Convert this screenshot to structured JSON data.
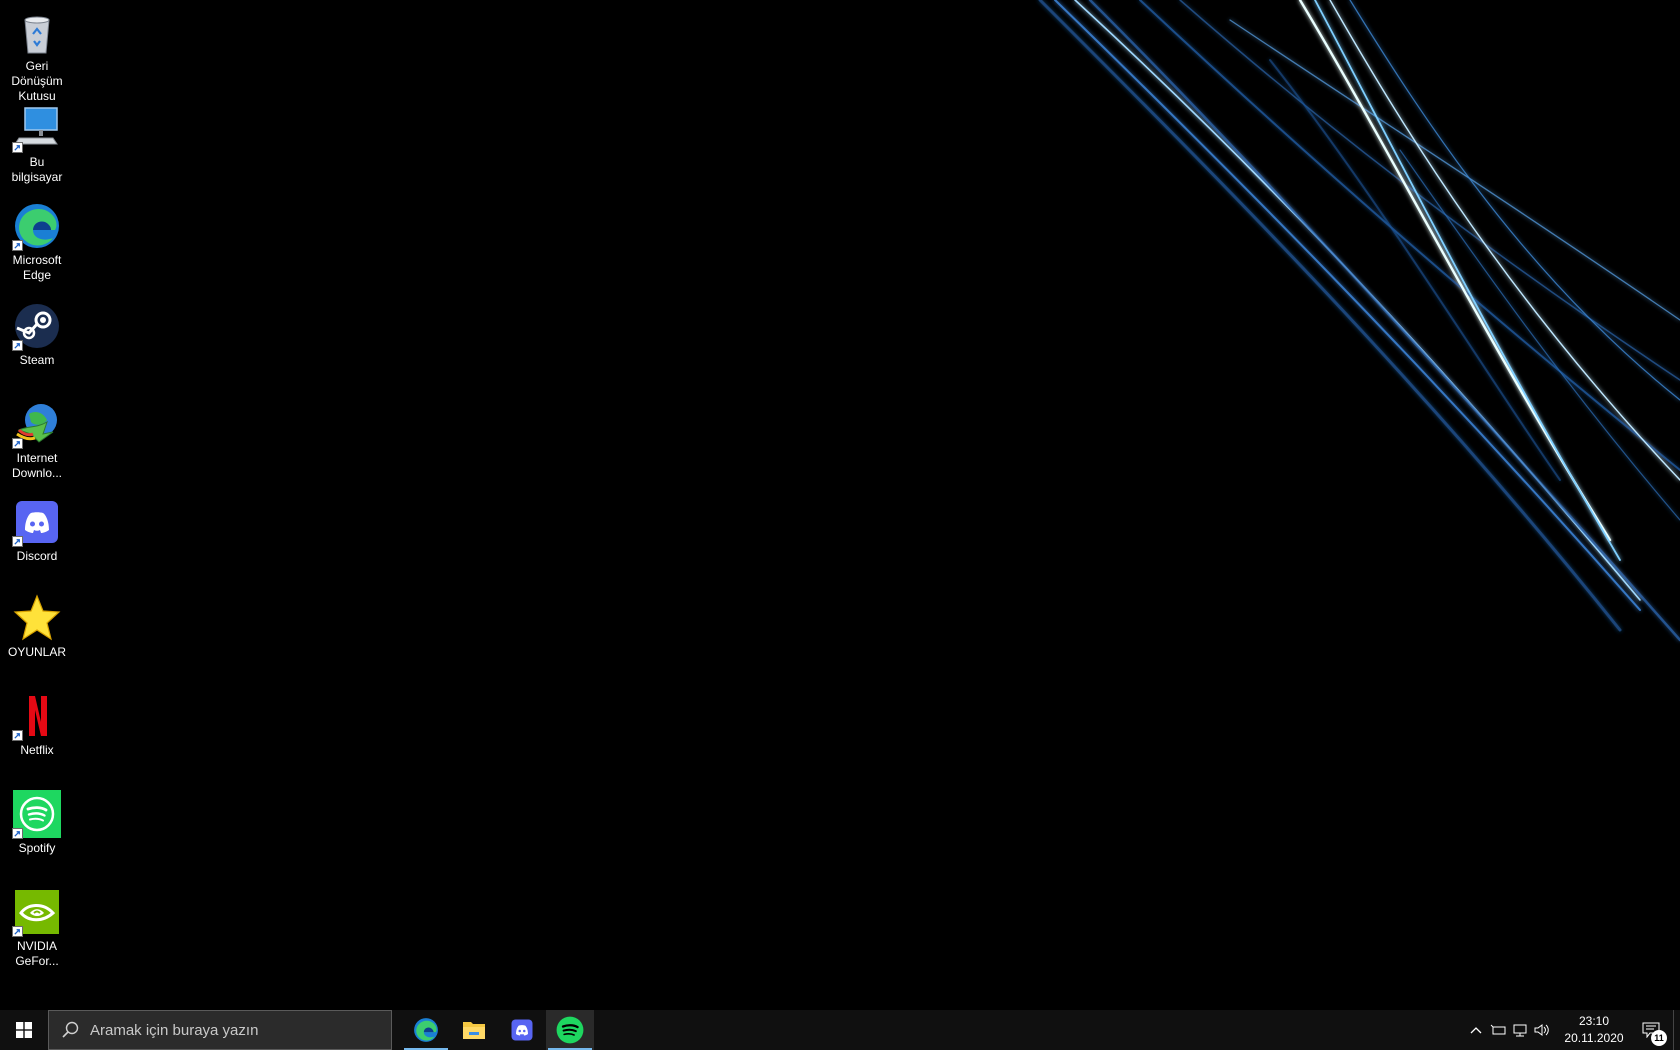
{
  "desktop": {
    "icons": [
      {
        "label": "Geri Dönüşüm Kutusu",
        "icon": "recycle-bin-icon"
      },
      {
        "label": "Bu bilgisayar",
        "icon": "computer-icon"
      },
      {
        "label": "Microsoft Edge",
        "icon": "edge-icon"
      },
      {
        "label": "Steam",
        "icon": "steam-icon"
      },
      {
        "label": "Internet Downlo...",
        "icon": "idm-icon"
      },
      {
        "label": "Discord",
        "icon": "discord-icon"
      },
      {
        "label": "OYUNLAR",
        "icon": "star-icon"
      },
      {
        "label": "Netflix",
        "icon": "netflix-icon"
      },
      {
        "label": "Spotify",
        "icon": "spotify-icon"
      },
      {
        "label": "NVIDIA GeFor...",
        "icon": "nvidia-icon"
      }
    ]
  },
  "taskbar": {
    "search_placeholder": "Aramak için buraya yazın",
    "pinned_apps": [
      "edge-icon",
      "file-explorer-icon",
      "discord-icon",
      "spotify-icon"
    ],
    "clock_time": "23:10",
    "clock_date": "20.11.2020",
    "notification_count": "11",
    "accent_color": "#76b9ed"
  },
  "colors": {
    "spotify": "#1ed760",
    "discord": "#5865f2",
    "nvidia": "#76b900",
    "netflix": "#e50914"
  }
}
